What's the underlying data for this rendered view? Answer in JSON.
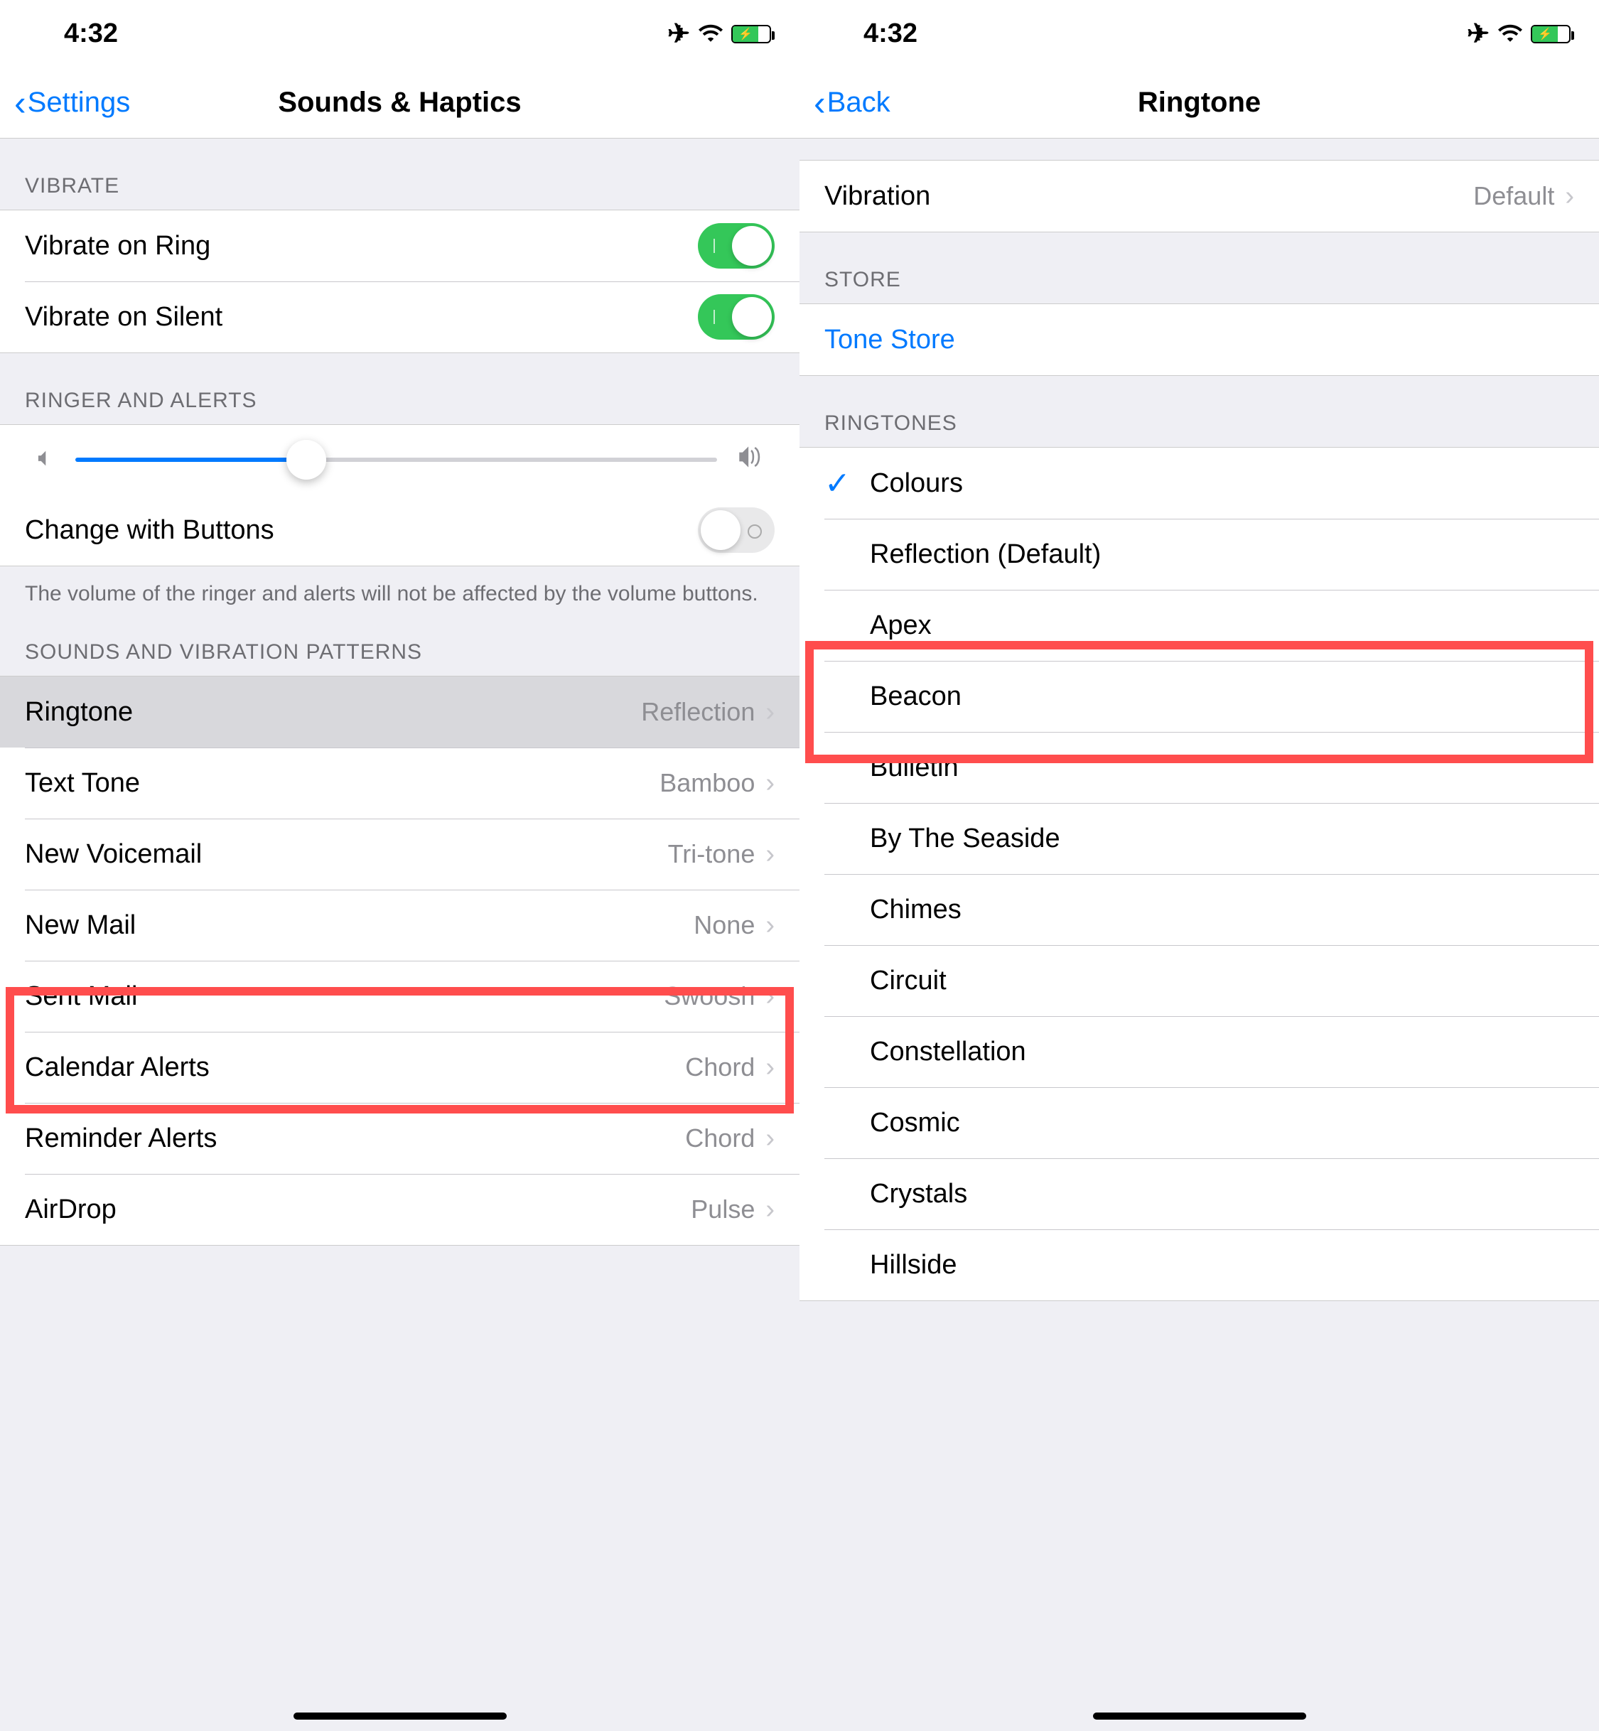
{
  "status": {
    "time": "4:32"
  },
  "left": {
    "back": "Settings",
    "title": "Sounds & Haptics",
    "sec_vibrate": "VIBRATE",
    "vibrate_ring": "Vibrate on Ring",
    "vibrate_silent": "Vibrate on Silent",
    "sec_ringer": "RINGER AND ALERTS",
    "change_buttons": "Change with Buttons",
    "footer_volume": "The volume of the ringer and alerts will not be affected by the volume buttons.",
    "sec_sounds": "SOUNDS AND VIBRATION PATTERNS",
    "rows": {
      "ringtone": {
        "label": "Ringtone",
        "value": "Reflection"
      },
      "texttone": {
        "label": "Text Tone",
        "value": "Bamboo"
      },
      "voicemail": {
        "label": "New Voicemail",
        "value": "Tri-tone"
      },
      "newmail": {
        "label": "New Mail",
        "value": "None"
      },
      "sentmail": {
        "label": "Sent Mail",
        "value": "Swoosh"
      },
      "calendar": {
        "label": "Calendar Alerts",
        "value": "Chord"
      },
      "reminder": {
        "label": "Reminder Alerts",
        "value": "Chord"
      },
      "airdrop": {
        "label": "AirDrop",
        "value": "Pulse"
      }
    }
  },
  "right": {
    "back": "Back",
    "title": "Ringtone",
    "vibration": {
      "label": "Vibration",
      "value": "Default"
    },
    "sec_store": "STORE",
    "tone_store": "Tone Store",
    "sec_ringtones": "RINGTONES",
    "tones": {
      "colours": "Colours",
      "reflection": "Reflection (Default)",
      "apex": "Apex",
      "beacon": "Beacon",
      "bulletin": "Bulletin",
      "seaside": "By The Seaside",
      "chimes": "Chimes",
      "circuit": "Circuit",
      "constellation": "Constellation",
      "cosmic": "Cosmic",
      "crystals": "Crystals",
      "hillside": "Hillside"
    }
  }
}
